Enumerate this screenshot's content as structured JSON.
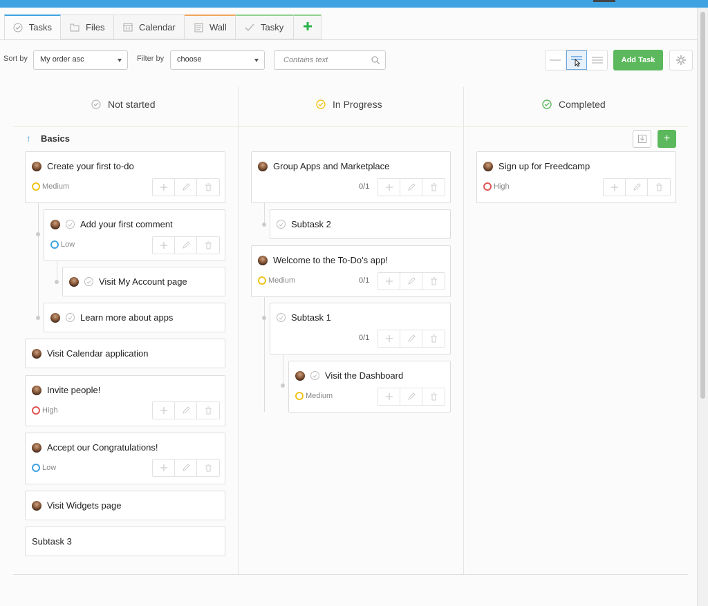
{
  "tabs": [
    {
      "label": "Tasks",
      "icon": "check-circle-icon"
    },
    {
      "label": "Files",
      "icon": "folder-icon"
    },
    {
      "label": "Calendar",
      "icon": "calendar-icon"
    },
    {
      "label": "Wall",
      "icon": "wall-icon"
    },
    {
      "label": "Tasky",
      "icon": "checkmark-icon"
    },
    {
      "label": "",
      "icon": "plus-icon"
    }
  ],
  "toolbar": {
    "sort_label": "Sort by",
    "sort_value": "My order asc",
    "filter_label": "Filter by",
    "filter_value": "choose",
    "search_placeholder": "Contains text",
    "add_task_label": "Add Task"
  },
  "columns": [
    {
      "label": "Not started",
      "status_color": "#b5b5b5"
    },
    {
      "label": "In Progress",
      "status_color": "#f0c419"
    },
    {
      "label": "Completed",
      "status_color": "#5cb85c"
    }
  ],
  "group": {
    "title": "Basics"
  },
  "priorities": {
    "Medium": "#f0c419",
    "Low": "#3ea3e0",
    "High": "#e05555"
  },
  "tasks": {
    "ns1": {
      "title": "Create your first to-do",
      "priority": "Medium"
    },
    "ns2": {
      "title": "Add your first comment",
      "priority": "Low"
    },
    "ns3": {
      "title": "Visit My Account page"
    },
    "ns4": {
      "title": "Learn more about apps"
    },
    "ns5": {
      "title": "Visit Calendar application"
    },
    "ns6": {
      "title": "Invite people!",
      "priority": "High"
    },
    "ns7": {
      "title": "Accept our Congratulations!",
      "priority": "Low"
    },
    "ns8": {
      "title": "Visit Widgets page"
    },
    "ns9": {
      "title": "Subtask 3"
    },
    "ip1": {
      "title": "Group Apps and Marketplace",
      "progress": "0/1"
    },
    "ip2": {
      "title": "Subtask 2"
    },
    "ip3": {
      "title": "Welcome to the To-Do's app!",
      "priority": "Medium",
      "progress": "0/1"
    },
    "ip4": {
      "title": "Subtask 1",
      "progress": "0/1"
    },
    "ip5": {
      "title": "Visit the Dashboard",
      "priority": "Medium"
    },
    "c1": {
      "title": "Sign up for Freedcamp",
      "priority": "High"
    }
  }
}
